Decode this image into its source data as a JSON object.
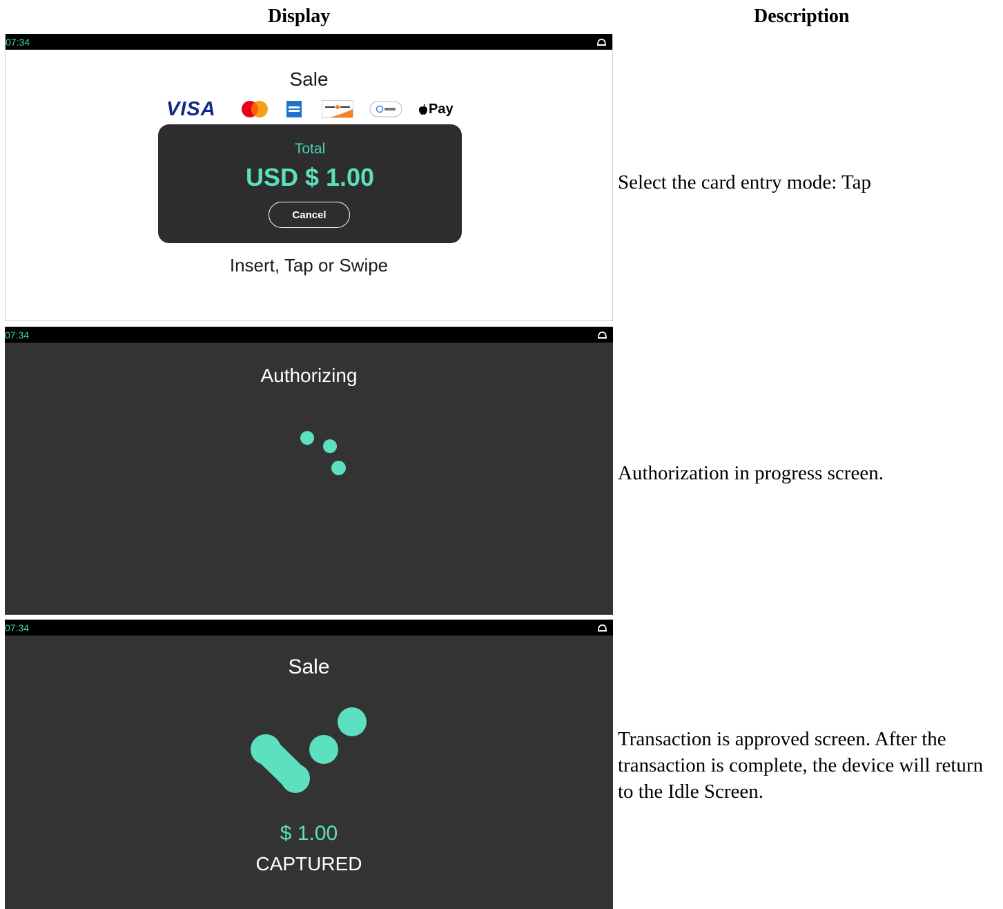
{
  "headers": {
    "display": "Display",
    "description": "Description"
  },
  "accent_color": "#46d7b4",
  "screens": [
    {
      "clock": "07:34",
      "status_icon": "cloud-icon",
      "title": "Sale",
      "card_brands": [
        "visa-logo",
        "mastercard-logo",
        "amex-logo",
        "discover-logo",
        "google-pay-logo",
        "apple-pay-logo"
      ],
      "visa_text": "VISA",
      "apple_pay_text": "Pay",
      "total_label": "Total",
      "total_amount": "USD $ 1.00",
      "cancel_label": "Cancel",
      "instruction": "Insert, Tap or Swipe"
    },
    {
      "clock": "07:34",
      "status_icon": "cloud-icon",
      "title": "Authorizing",
      "indicator": "spinner-dots"
    },
    {
      "clock": "07:34",
      "status_icon": "cloud-icon",
      "title": "Sale",
      "indicator": "approved-checkmark",
      "amount": "$ 1.00",
      "status": "CAPTURED"
    }
  ],
  "descriptions": [
    "Select the card entry mode: Tap",
    "Authorization in progress screen.",
    "Transaction is approved screen. After the transaction is complete, the device will return to the Idle Screen."
  ]
}
